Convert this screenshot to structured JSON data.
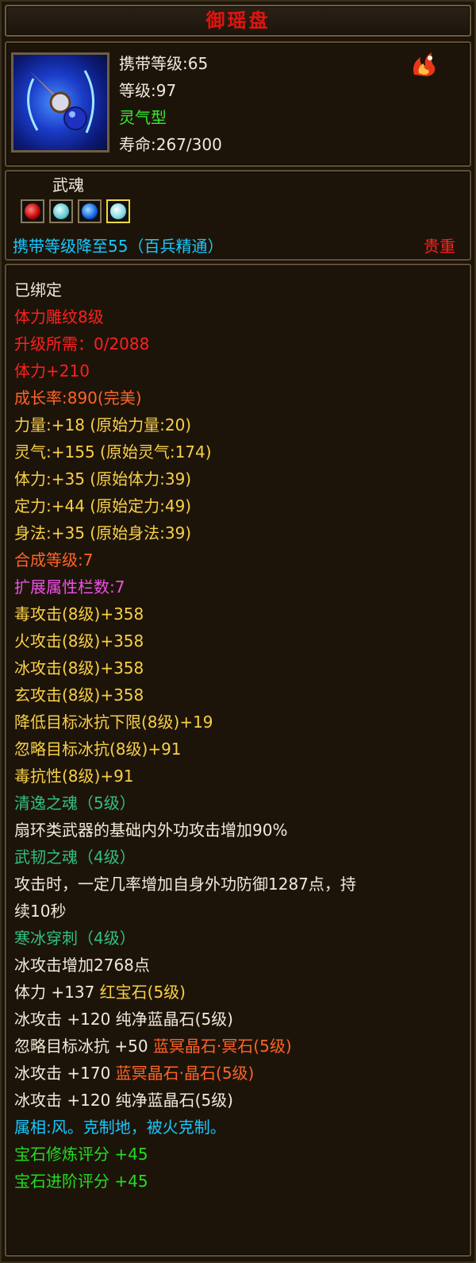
{
  "title": "御瑶盘",
  "item_icon": "fan-ring-weapon-icon",
  "corner_icon": "flame-emblem-icon",
  "header_stats": {
    "carry_level": "携带等级:65",
    "level": "等级:97",
    "type": "灵气型",
    "lifespan": "寿命:267/300"
  },
  "soul": {
    "label": "武魂",
    "gems": [
      "red-soul-gem-icon",
      "teal-soul-gem-icon",
      "blue-soul-gem-icon",
      "teal-soul-gem-selected-icon"
    ],
    "carry_reduce": "携带等级降至55（百兵精通）",
    "rarity": "贵重"
  },
  "attributes": [
    {
      "text": "已绑定",
      "color": "white"
    },
    {
      "text": "体力雕纹8级",
      "color": "red"
    },
    {
      "text": "升级所需：0/2088",
      "color": "red"
    },
    {
      "text": "体力+210",
      "color": "red"
    },
    {
      "text": "成长率:890(完美)",
      "color": "orange"
    },
    {
      "text": "力量:+18 (原始力量:20)",
      "color": "gold"
    },
    {
      "text": "灵气:+155 (原始灵气:174)",
      "color": "gold"
    },
    {
      "text": "体力:+35 (原始体力:39)",
      "color": "gold"
    },
    {
      "text": "定力:+44 (原始定力:49)",
      "color": "gold"
    },
    {
      "text": "身法:+35 (原始身法:39)",
      "color": "gold"
    },
    {
      "text": "合成等级:7",
      "color": "orange"
    },
    {
      "text": "扩展属性栏数:7",
      "color": "pink"
    },
    {
      "text": "毒攻击(8级)+358",
      "color": "gold"
    },
    {
      "text": "火攻击(8级)+358",
      "color": "gold"
    },
    {
      "text": "冰攻击(8级)+358",
      "color": "gold"
    },
    {
      "text": "玄攻击(8级)+358",
      "color": "gold"
    },
    {
      "text": "降低目标冰抗下限(8级)+19",
      "color": "gold"
    },
    {
      "text": "忽略目标冰抗(8级)+91",
      "color": "gold"
    },
    {
      "text": "毒抗性(8级)+91",
      "color": "gold"
    },
    {
      "text": "清逸之魂（5级）",
      "color": "teal"
    },
    {
      "text": "扇环类武器的基础内外功攻击增加90%",
      "color": "white"
    },
    {
      "text": "武韧之魂（4级）",
      "color": "teal"
    },
    {
      "text": "攻击时，一定几率增加自身外功防御1287点，持",
      "color": "white"
    },
    {
      "text": "续10秒",
      "color": "white"
    },
    {
      "text": "寒冰穿刺（4级）",
      "color": "teal"
    },
    {
      "text": "冰攻击增加2768点",
      "color": "white"
    }
  ],
  "gem_lines": [
    {
      "stat": "体力 +137",
      "gem": "红宝石(5级)",
      "gem_color": "gold"
    },
    {
      "stat": "冰攻击 +120",
      "gem": "纯净蓝晶石(5级)",
      "gem_color": "white"
    },
    {
      "stat": "忽略目标冰抗 +50",
      "gem": "蓝冥晶石·冥石(5级)",
      "gem_color": "orange"
    },
    {
      "stat": "冰攻击 +170",
      "gem": "蓝冥晶石·晶石(5级)",
      "gem_color": "orange"
    },
    {
      "stat": "冰攻击 +120",
      "gem": "纯净蓝晶石(5级)",
      "gem_color": "white"
    }
  ],
  "footer": [
    {
      "text": "属相:风。克制地，被火克制。",
      "color": "cyan"
    },
    {
      "text": "宝石修炼评分 +45",
      "color": "ltgreen"
    },
    {
      "text": "宝石进阶评分 +45",
      "color": "ltgreen"
    }
  ]
}
